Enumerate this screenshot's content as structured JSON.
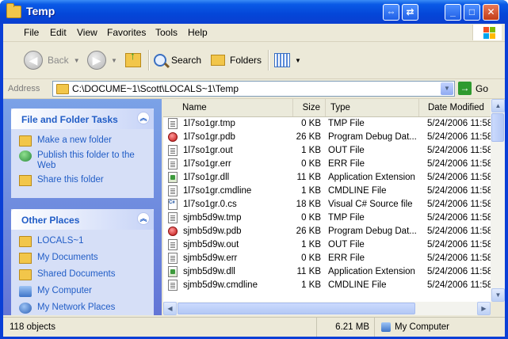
{
  "window": {
    "title": "Temp",
    "buttons": {
      "restore_alt": "⇔",
      "swap": "⇄",
      "minimize": "_",
      "maximize": "□",
      "close": "✕"
    }
  },
  "menu": [
    "File",
    "Edit",
    "View",
    "Favorites",
    "Tools",
    "Help"
  ],
  "toolbar": {
    "back_label": "Back",
    "search_label": "Search",
    "folders_label": "Folders"
  },
  "address": {
    "label": "Address",
    "path": "C:\\DOCUME~1\\Scott\\LOCALS~1\\Temp",
    "go_label": "Go"
  },
  "tasks_panel": {
    "title": "File and Folder Tasks",
    "items": [
      "Make a new folder",
      "Publish this folder to the Web",
      "Share this folder"
    ]
  },
  "places_panel": {
    "title": "Other Places",
    "items": [
      "LOCALS~1",
      "My Documents",
      "Shared Documents",
      "My Computer",
      "My Network Places"
    ]
  },
  "columns": {
    "name": "Name",
    "size": "Size",
    "type": "Type",
    "date": "Date Modified"
  },
  "files": [
    {
      "name": "1l7so1gr.tmp",
      "size": "0 KB",
      "type": "TMP File",
      "date": "5/24/2006 11:58",
      "icon": "txt"
    },
    {
      "name": "1l7so1gr.pdb",
      "size": "26 KB",
      "type": "Program Debug Dat...",
      "date": "5/24/2006 11:58",
      "icon": "pdb"
    },
    {
      "name": "1l7so1gr.out",
      "size": "1 KB",
      "type": "OUT File",
      "date": "5/24/2006 11:58",
      "icon": "txt"
    },
    {
      "name": "1l7so1gr.err",
      "size": "0 KB",
      "type": "ERR File",
      "date": "5/24/2006 11:58",
      "icon": "txt"
    },
    {
      "name": "1l7so1gr.dll",
      "size": "11 KB",
      "type": "Application Extension",
      "date": "5/24/2006 11:58",
      "icon": "dll"
    },
    {
      "name": "1l7so1gr.cmdline",
      "size": "1 KB",
      "type": "CMDLINE File",
      "date": "5/24/2006 11:58",
      "icon": "txt"
    },
    {
      "name": "1l7so1gr.0.cs",
      "size": "18 KB",
      "type": "Visual C# Source file",
      "date": "5/24/2006 11:58",
      "icon": "cs"
    },
    {
      "name": "sjmb5d9w.tmp",
      "size": "0 KB",
      "type": "TMP File",
      "date": "5/24/2006 11:58",
      "icon": "txt"
    },
    {
      "name": "sjmb5d9w.pdb",
      "size": "26 KB",
      "type": "Program Debug Dat...",
      "date": "5/24/2006 11:58",
      "icon": "pdb"
    },
    {
      "name": "sjmb5d9w.out",
      "size": "1 KB",
      "type": "OUT File",
      "date": "5/24/2006 11:58",
      "icon": "txt"
    },
    {
      "name": "sjmb5d9w.err",
      "size": "0 KB",
      "type": "ERR File",
      "date": "5/24/2006 11:58",
      "icon": "txt"
    },
    {
      "name": "sjmb5d9w.dll",
      "size": "11 KB",
      "type": "Application Extension",
      "date": "5/24/2006 11:58",
      "icon": "dll"
    },
    {
      "name": "sjmb5d9w.cmdline",
      "size": "1 KB",
      "type": "CMDLINE File",
      "date": "5/24/2006 11:58",
      "icon": "txt"
    }
  ],
  "status": {
    "objects": "118 objects",
    "size": "6.21 MB",
    "location": "My Computer"
  }
}
